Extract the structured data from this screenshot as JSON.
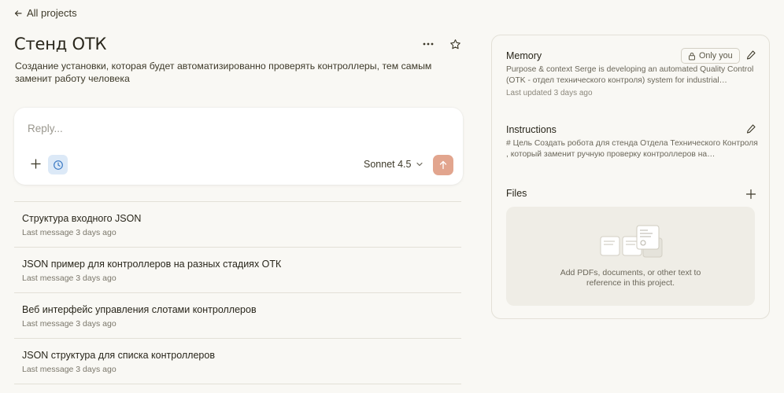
{
  "nav": {
    "back_label": "All projects"
  },
  "project": {
    "title": "Стенд ОТК",
    "description": "Создание установки, которая будет автоматизированно проверять контроллеры, тем самым заменит работу человека"
  },
  "composer": {
    "placeholder": "Reply...",
    "model_label": "Sonnet 4.5"
  },
  "chats": [
    {
      "title": "Структура входного JSON",
      "meta": "Last message 3 days ago"
    },
    {
      "title": "JSON пример для контроллеров на разных стадиях ОТК",
      "meta": "Last message 3 days ago"
    },
    {
      "title": "Веб интерфейс управления слотами контроллеров",
      "meta": "Last message 3 days ago"
    },
    {
      "title": "JSON структура для списка контроллеров",
      "meta": "Last message 3 days ago"
    }
  ],
  "memory": {
    "title": "Memory",
    "badge": "Only you",
    "text": "Purpose & context Serge is developing an automated Quality Control (OTK - отдел технического контроля) system for industrial…",
    "updated": "Last updated 3 days ago"
  },
  "instructions": {
    "title": "Instructions",
    "text": "# Цель Создать робота для стенда Отдела Технического Контроля , который заменит ручную проверку контроллеров на…"
  },
  "files": {
    "title": "Files",
    "empty_text_1": "Add PDFs, documents, or other text to",
    "empty_text_2": "reference in this project."
  },
  "colors": {
    "accent_send": "#e2a58e",
    "history_bg": "#dce9f7",
    "page_bg": "#f9f8f4"
  }
}
